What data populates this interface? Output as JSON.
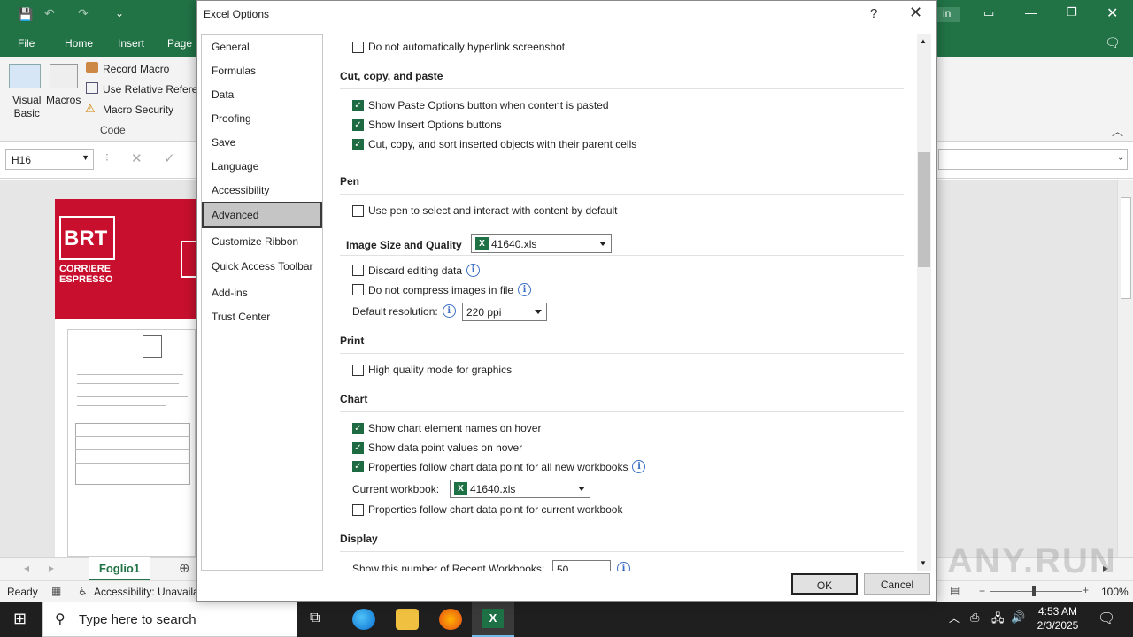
{
  "excel": {
    "tabs": [
      "File",
      "Home",
      "Insert",
      "Page I"
    ],
    "signin": "in",
    "ribbon": {
      "visual_basic": [
        "Visual",
        "Basic"
      ],
      "macros": "Macros",
      "record_macro": "Record Macro",
      "relative": "Use Relative Referen",
      "security": "Macro Security",
      "group_code": "Code"
    },
    "name_box": "H16",
    "sheet_tab": "Foglio1",
    "status_ready": "Ready",
    "status_accessibility": "Accessibility: Unavailal",
    "zoom": "100%",
    "brt": [
      "BRT",
      "CORRIERE",
      "ESPRESSO"
    ]
  },
  "dialog": {
    "title": "Excel Options",
    "help": "?",
    "close": "✕",
    "nav": [
      "General",
      "Formulas",
      "Data",
      "Proofing",
      "Save",
      "Language",
      "Accessibility",
      "Advanced",
      "Customize Ribbon",
      "Quick Access Toolbar",
      "Add-ins",
      "Trust Center"
    ],
    "selected_nav": "Advanced",
    "hyperlink": "Do not automatically hyperlink screenshot",
    "cut_copy_header": "Cut, copy, and paste",
    "paste_options": "Show Paste Options button when content is pasted",
    "insert_options": "Show Insert Options buttons",
    "cut_copy_sort": "Cut, copy, and sort inserted objects with their parent cells",
    "pen_header": "Pen",
    "use_pen": "Use pen to select and interact with content by default",
    "image_header": "Image Size and Quality",
    "image_workbook": "41640.xls",
    "discard_editing": "Discard editing data",
    "no_compress": "Do not compress images in file",
    "default_resolution_label": "Default resolution:",
    "default_resolution": "220 ppi",
    "print_header": "Print",
    "high_quality": "High quality mode for graphics",
    "chart_header": "Chart",
    "chart_names": "Show chart element names on hover",
    "data_point_values": "Show data point values on hover",
    "props_all": "Properties follow chart data point for all new workbooks",
    "current_workbook_label": "Current workbook:",
    "current_workbook": "41640.xls",
    "props_current": "Properties follow chart data point for current workbook",
    "display_header": "Display",
    "recent_workbooks": "Show this number of Recent Workbooks:",
    "recent_count": "50",
    "ok": "OK",
    "cancel": "Cancel"
  },
  "taskbar": {
    "search_placeholder": "Type here to search",
    "time": "4:53 AM",
    "date": "2/3/2025"
  },
  "watermark": "ANY.RUN"
}
